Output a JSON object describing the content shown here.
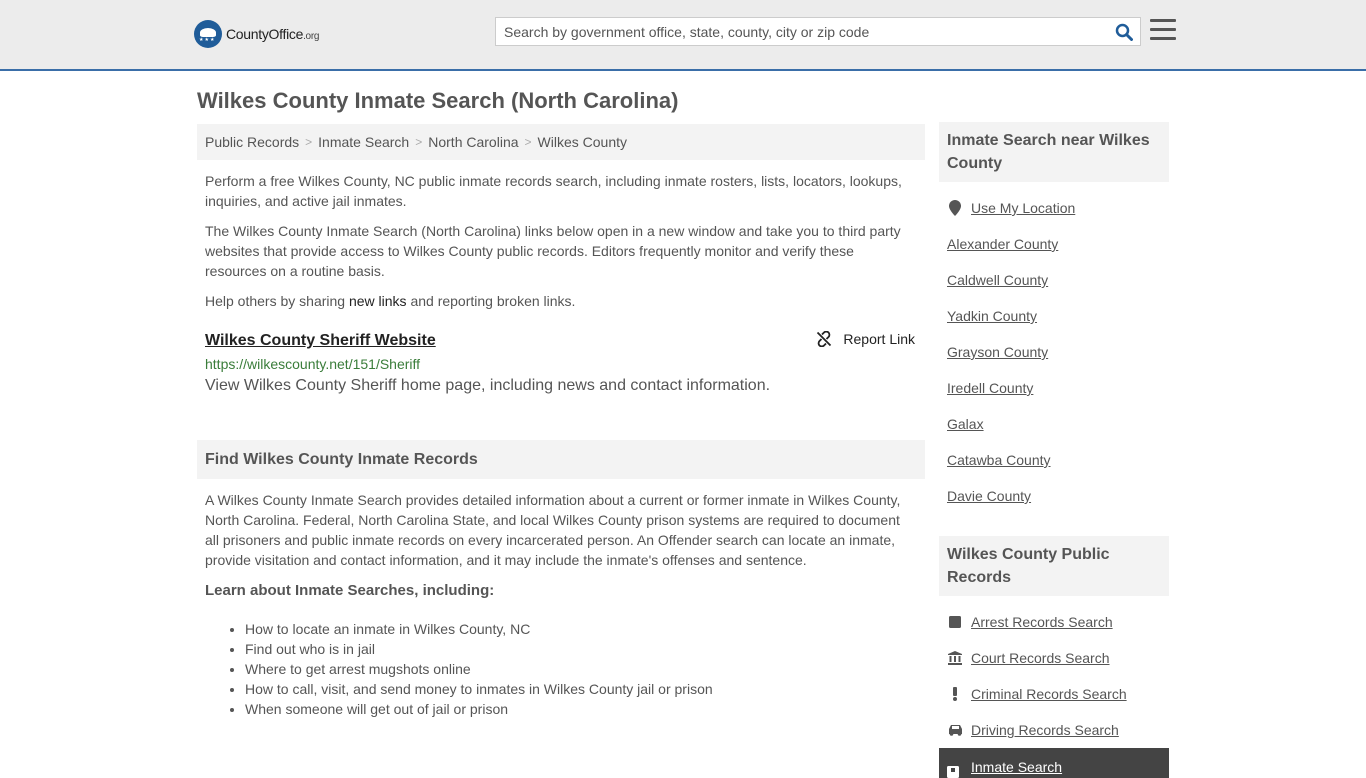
{
  "header": {
    "logo_main": "CountyOffice",
    "logo_suffix": ".org",
    "search_placeholder": "Search by government office, state, county, city or zip code"
  },
  "page": {
    "title": "Wilkes County Inmate Search (North Carolina)"
  },
  "breadcrumb": [
    "Public Records",
    "Inmate Search",
    "North Carolina",
    "Wilkes County"
  ],
  "intro": {
    "p1": "Perform a free Wilkes County, NC public inmate records search, including inmate rosters, lists, locators, lookups, inquiries, and active jail inmates.",
    "p2": "The Wilkes County Inmate Search (North Carolina) links below open in a new window and take you to third party websites that provide access to Wilkes County public records. Editors frequently monitor and verify these resources on a routine basis.",
    "p3_before": "Help others by sharing ",
    "p3_link": "new links",
    "p3_after": " and reporting broken links."
  },
  "link_entry": {
    "title": "Wilkes County Sheriff Website",
    "url": "https://wilkescounty.net/151/Sheriff",
    "description": "View Wilkes County Sheriff home page, including news and contact information.",
    "report_label": "Report Link"
  },
  "find_section": {
    "heading": "Find Wilkes County Inmate Records",
    "body": "A Wilkes County Inmate Search provides detailed information about a current or former inmate in Wilkes County, North Carolina. Federal, North Carolina State, and local Wilkes County prison systems are required to document all prisoners and public inmate records on every incarcerated person. An Offender search can locate an inmate, provide visitation and contact information, and it may include the inmate's offenses and sentence.",
    "learn_heading": "Learn about Inmate Searches, including:",
    "bullets": [
      "How to locate an inmate in Wilkes County, NC",
      "Find out who is in jail",
      "Where to get arrest mugshots online",
      "How to call, visit, and send money to inmates in Wilkes County jail or prison",
      "When someone will get out of jail or prison"
    ]
  },
  "sidebar": {
    "nearby_heading": "Inmate Search near Wilkes County",
    "use_location": "Use My Location",
    "nearby": [
      "Alexander County",
      "Caldwell County",
      "Yadkin County",
      "Grayson County",
      "Iredell County",
      "Galax",
      "Catawba County",
      "Davie County"
    ],
    "records_heading": "Wilkes County Public Records",
    "records": [
      {
        "label": "Arrest Records Search",
        "icon": "square-icon"
      },
      {
        "label": "Court Records Search",
        "icon": "courthouse-icon"
      },
      {
        "label": "Criminal Records Search",
        "icon": "exclamation-icon"
      },
      {
        "label": "Driving Records Search",
        "icon": "car-icon"
      }
    ],
    "active_record": "Inmate Search"
  },
  "colors": {
    "header_bg": "#ececec",
    "header_border": "#3a6ea8",
    "logo_blue": "#1f5c99",
    "url_green": "#3a7d3a",
    "active_bg": "#444444"
  }
}
